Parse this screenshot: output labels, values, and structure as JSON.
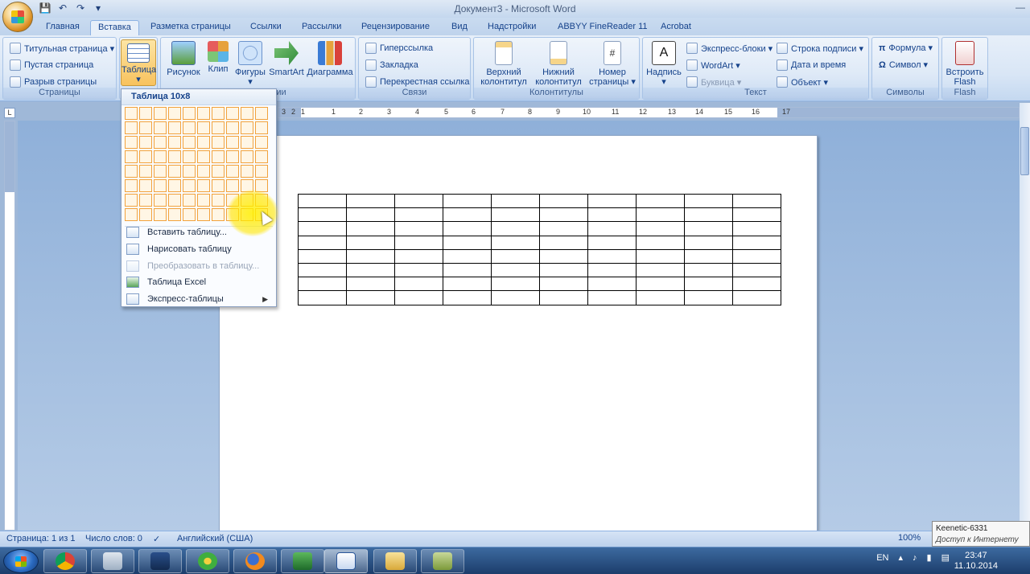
{
  "window": {
    "title": "Документ3 - Microsoft Word"
  },
  "qat": {
    "save": "💾",
    "undo": "↶",
    "redo": "↷",
    "customize": "▾"
  },
  "tabs": [
    "Главная",
    "Вставка",
    "Разметка страницы",
    "Ссылки",
    "Рассылки",
    "Рецензирование",
    "Вид",
    "Надстройки",
    "ABBYY FineReader 11",
    "Acrobat"
  ],
  "ribbon": {
    "pages": {
      "label": "Страницы",
      "items": [
        "Титульная страница ▾",
        "Пустая страница",
        "Разрыв страницы"
      ]
    },
    "tables": {
      "table": "Таблица ▾"
    },
    "illustrations": {
      "label": "Иллюстрации",
      "picture": "Рисунок",
      "clip": "Клип",
      "shapes": "Фигуры ▾",
      "smartart": "SmartArt",
      "chart": "Диаграмма"
    },
    "links": {
      "label": "Связи",
      "items": [
        "Гиперссылка",
        "Закладка",
        "Перекрестная ссылка"
      ]
    },
    "headers": {
      "label": "Колонтитулы",
      "header": "Верхний колонтитул ▾",
      "footer": "Нижний колонтитул ▾",
      "pagenum": "Номер страницы ▾"
    },
    "text": {
      "label": "Текст",
      "textbox": "Надпись ▾",
      "items": [
        "Экспресс-блоки ▾",
        "WordArt ▾",
        "Буквица ▾"
      ],
      "items2": [
        "Строка подписи ▾",
        "Дата и время",
        "Объект ▾"
      ]
    },
    "symbols": {
      "label": "Символы",
      "items": [
        "Формула ▾",
        "Символ ▾"
      ]
    },
    "flash": {
      "label": "Flash",
      "embed": "Встроить Flash"
    }
  },
  "dropdown": {
    "title": "Таблица 10x8",
    "items": [
      "Вставить таблицу...",
      "Нарисовать таблицу",
      "Преобразовать в таблицу...",
      "Таблица Excel",
      "Экспресс-таблицы"
    ]
  },
  "status": {
    "page": "Страница: 1 из 1",
    "words": "Число слов: 0",
    "lang": "Английский (США)",
    "zoom": "100%"
  },
  "tooltip": {
    "line1": "Keenetic-6331",
    "line2": "Доступ к Интернету"
  },
  "tray": {
    "lang": "EN",
    "time": "23:47",
    "date": "11.10.2014"
  },
  "ruler": [
    "3",
    "2",
    "1",
    "1",
    "2",
    "3",
    "4",
    "5",
    "6",
    "7",
    "8",
    "9",
    "10",
    "11",
    "12",
    "13",
    "14",
    "15",
    "16",
    "17"
  ]
}
